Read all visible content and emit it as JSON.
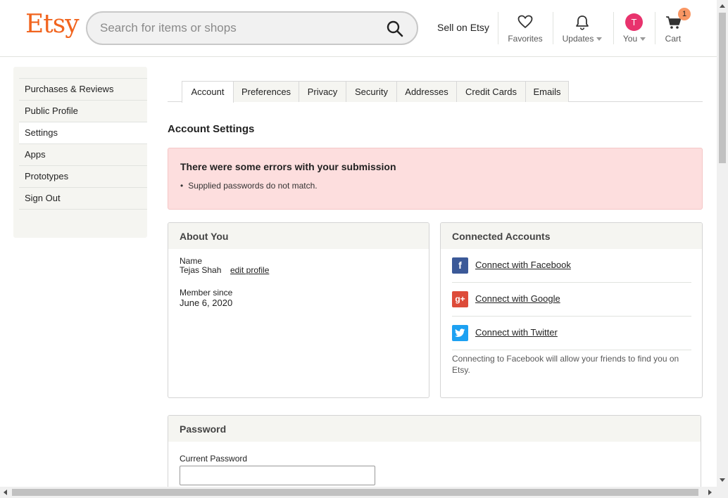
{
  "header": {
    "logo": "Etsy",
    "search_placeholder": "Search for items or shops",
    "sell": "Sell on Etsy",
    "favorites": "Favorites",
    "updates": "Updates",
    "you": "You",
    "avatar_letter": "T",
    "cart": "Cart",
    "cart_count": "1",
    "accent_color": "#f1641e"
  },
  "sidebar": {
    "items": [
      {
        "label": "Purchases & Reviews"
      },
      {
        "label": "Public Profile"
      },
      {
        "label": "Settings",
        "active": true
      },
      {
        "label": "Apps"
      },
      {
        "label": "Prototypes"
      },
      {
        "label": "Sign Out"
      }
    ]
  },
  "tabs": [
    "Account",
    "Preferences",
    "Privacy",
    "Security",
    "Addresses",
    "Credit Cards",
    "Emails"
  ],
  "page": {
    "title": "Account Settings",
    "alert_title": "There were some errors with your submission",
    "alert_message": "Supplied passwords do not match."
  },
  "about": {
    "heading": "About You",
    "name_label": "Name",
    "name_value": "Tejas Shah",
    "edit_link": "edit profile",
    "member_label": "Member since",
    "member_value": "June 6, 2020"
  },
  "connected": {
    "heading": "Connected Accounts",
    "facebook": "Connect with Facebook",
    "google": "Connect with Google",
    "twitter": "Connect with Twitter",
    "note": "Connecting to Facebook will allow your friends to find you on Etsy."
  },
  "password": {
    "heading": "Password",
    "current_label": "Current Password"
  }
}
